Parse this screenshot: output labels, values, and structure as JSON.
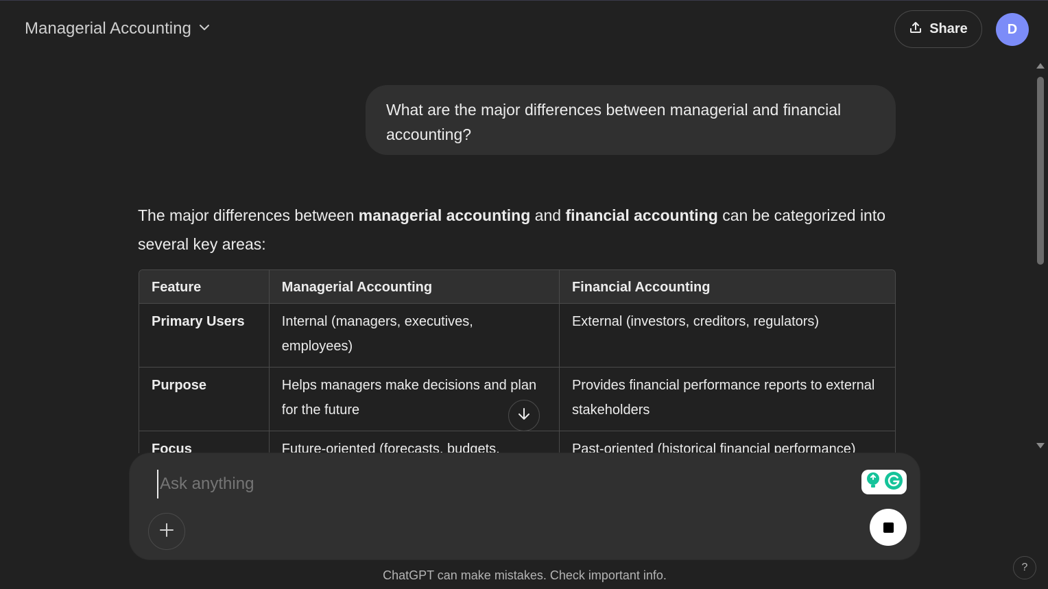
{
  "header": {
    "title": "Managerial Accounting",
    "share_label": "Share",
    "avatar_initial": "D"
  },
  "conversation": {
    "user_message": "What are the major differences between managerial and financial accounting?",
    "assistant": {
      "intro_before": "The major differences between ",
      "intro_bold_1": "managerial accounting",
      "intro_mid": " and ",
      "intro_bold_2": "financial accounting",
      "intro_after": " can be categorized into several key areas:"
    },
    "table": {
      "headers": [
        "Feature",
        "Managerial Accounting",
        "Financial Accounting"
      ],
      "rows": [
        [
          "Primary Users",
          "Internal (managers, executives, employees)",
          "External (investors, creditors, regulators)"
        ],
        [
          "Purpose",
          "Helps managers make decisions and plan for the future",
          "Provides financial performance reports to external stakeholders"
        ],
        [
          "Focus",
          "Future-oriented (forecasts, budgets,",
          "Past-oriented (historical financial performance)"
        ]
      ]
    }
  },
  "composer": {
    "placeholder": "Ask anything"
  },
  "footer": {
    "disclaimer": "ChatGPT can make mistakes. Check important info.",
    "help_label": "?"
  },
  "icons": {
    "title_dropdown": "chevron-down-icon",
    "share": "upload-icon",
    "scroll_down": "arrow-down-icon",
    "attach": "plus-icon",
    "stop": "stop-icon",
    "extension": "grammarly-icon"
  },
  "colors": {
    "background": "#212121",
    "bubble": "#303030",
    "avatar": "#7c8cf8",
    "text": "#ececec",
    "grammarly": "#15c39a"
  }
}
